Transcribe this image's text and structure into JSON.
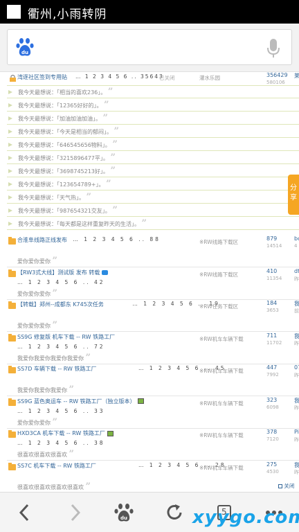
{
  "status_bar": {
    "title": "衢州,小雨转阴"
  },
  "search": {
    "placeholder": ""
  },
  "top_thread": {
    "title": "湾逐社区签到专用贴",
    "pages": "… 1 2 3 4 5 6 .. 35643",
    "status": "已关闭",
    "forum": "灌水乐园",
    "replies": "356429",
    "views": "580106",
    "last": "莱"
  },
  "quotes": [
    "我今天最想说：「相当的喜欢236」。",
    "我今天最想说：「12365好好的」。",
    "我今天最想说：「加油加油加油」。",
    "我今天最想说：「今天是相当的郁闷」。",
    "我今天最想说：「646545656物料」。",
    "我今天最想说：「3215896477平」。",
    "我今天最想说：「3698745213好」。",
    "我今天最想说：「123654789+」。",
    "我今天最想说：「天气热」。",
    "我今天最想说：「987654321交友」。",
    "我今天最想说：「每天都是这样重复昨天的生活」。"
  ],
  "threads": [
    {
      "title": "合淮阜线路正线发布",
      "pages": "… 1 2 3 4 5 6 .. 88",
      "pages_inline": true,
      "forum": "※RW线路下载区",
      "replies": "879",
      "views": "14514",
      "last": "bo",
      "lastsub": "4",
      "reply": "爱你爱你爱你"
    },
    {
      "title": "【RW3式大线】测试版 发布 转载",
      "pages": "… 1 2 3 4 5 6 .. 42",
      "pages_inline": false,
      "forum": "※RW线路下载区",
      "replies": "410",
      "views": "11354",
      "last": "dt",
      "lastsub": "昨",
      "reply": "爱你爱你爱你",
      "badge": "blue"
    },
    {
      "title": "【转载】郑州--成都东 K745次任务",
      "pages": "… 1 2 3 4 5 6 .. 19",
      "pages_inline": true,
      "forum": "※RW任务下载区",
      "replies": "184",
      "views": "3653",
      "last": "我",
      "lastsub": "前",
      "reply": "爱你爱你爱你"
    },
    {
      "title": "SS9G 修复版 机车下载 -- RW 铁路工厂",
      "pages": "… 1 2 3 4 5 6 .. 72",
      "pages_inline": false,
      "forum": "※RW机车车辆下载",
      "replies": "711",
      "views": "11702",
      "last": "我",
      "lastsub": "昨",
      "reply": "我爱你我爱你我爱你我爱你"
    },
    {
      "title": "SS7D 车辆下载 -- RW 铁路工厂",
      "pages": "… 1 2 3 4 5 6 .. 45",
      "pages_inline": true,
      "forum": "※RW机车车辆下载",
      "replies": "447",
      "views": "7992",
      "last": "07",
      "lastsub": "昨",
      "reply": "我爱你我爱你我爱你"
    },
    {
      "title": "SS9G 蓝色奥运车 -- RW 铁路工厂（独立版本）",
      "pages": "… 1 2 3 4 5 6 .. 33",
      "pages_inline": false,
      "forum": "※RW机车车辆下载",
      "replies": "323",
      "views": "6098",
      "last": "我",
      "lastsub": "昨",
      "reply": "爱你爱你爱你",
      "badge": "img"
    },
    {
      "title": "HXD3CA 机车下载 -- RW 铁路工厂",
      "pages": "… 1 2 3 4 5 6 .. 38",
      "pages_inline": false,
      "forum": "※RW机车车辆下载",
      "replies": "378",
      "views": "7120",
      "last": "Pi",
      "lastsub": "昨",
      "reply": "很喜欢很喜欢很喜欢",
      "badge": "img"
    },
    {
      "title": "SS7C 机车下载 -- RW 铁路工厂",
      "pages": "… 1 2 3 4 5 6 .. 28",
      "pages_inline": true,
      "forum": "※RW机车车辆下载",
      "replies": "275",
      "views": "4530",
      "last": "我",
      "lastsub": "昨",
      "reply": "很喜欢很喜欢很喜欢很喜欢"
    }
  ],
  "share_label": "分享",
  "close_label": "关闭",
  "bottom_nav": {
    "tabs_count": "5",
    "watermark": "xyygo.com"
  },
  "colors": {
    "status_bg": "#000000",
    "link": "#336699",
    "folder": "#f4b03a",
    "share": "#f5a623",
    "watermark": "#1aa3e8"
  }
}
